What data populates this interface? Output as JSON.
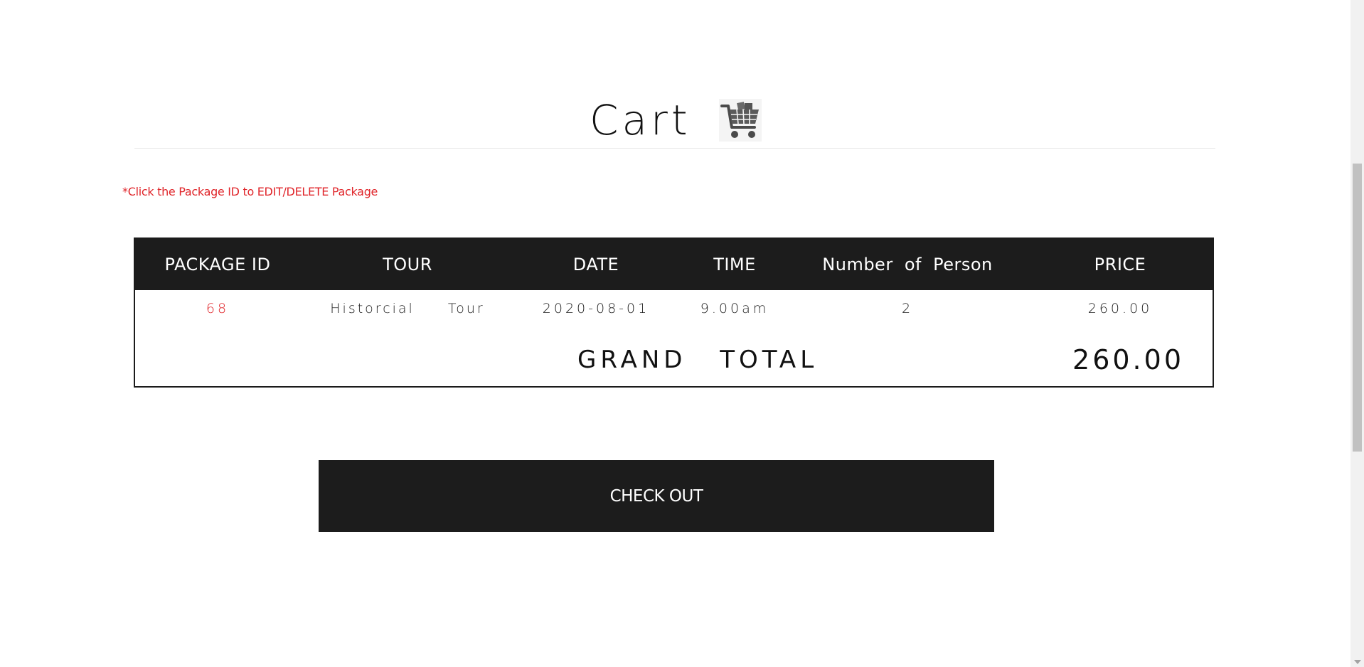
{
  "page": {
    "title": "Cart",
    "cart_icon": "shopping-cart-icon"
  },
  "note": "*Click the Package ID to EDIT/DELETE Package",
  "table": {
    "columns": [
      "PACKAGE ID",
      "TOUR",
      "DATE",
      "TIME",
      "Number of Person",
      "PRICE"
    ],
    "rows": [
      {
        "package_id": "68",
        "tour": "Historcial Tour",
        "date": "2020-08-01",
        "time": "9.00am",
        "persons": "2",
        "price": "260.00"
      }
    ],
    "grand_total_label": "GRAND TOTAL",
    "grand_total_value": "260.00"
  },
  "checkout": {
    "label": "CHECK OUT"
  },
  "colors": {
    "dark": "#1c1c1c",
    "accent_red": "#e0262b",
    "text": "#111111"
  }
}
